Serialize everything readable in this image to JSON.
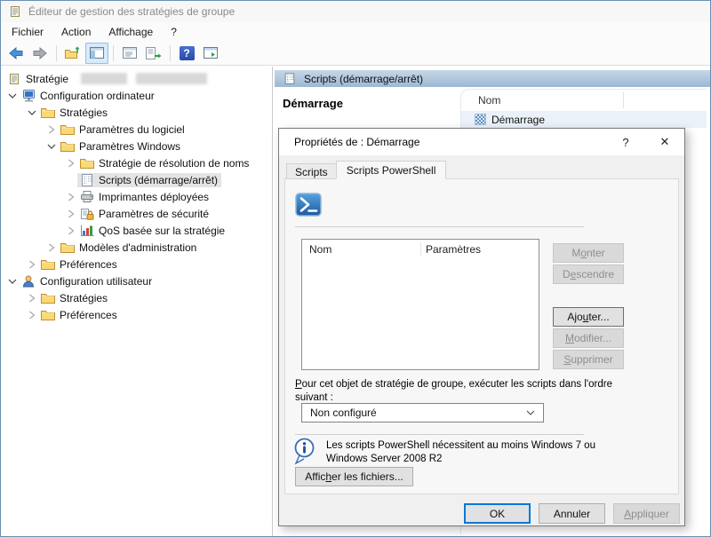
{
  "window": {
    "title": "Éditeur de gestion des stratégies de groupe",
    "menu": [
      "Fichier",
      "Action",
      "Affichage",
      "?"
    ],
    "toolbar_icons": [
      "back",
      "forward",
      "up-one-level",
      "show-console-tree",
      "properties",
      "export-list",
      "help",
      "extended-view"
    ],
    "help_glyph": "?"
  },
  "tree": {
    "items": [
      {
        "label": "Stratégie",
        "level": 0,
        "icon": "gpo-scroll",
        "expander": "none",
        "redacted": true
      },
      {
        "label": "Configuration ordinateur",
        "level": 1,
        "icon": "computer",
        "expander": "expanded"
      },
      {
        "label": "Stratégies",
        "level": 2,
        "icon": "folder",
        "expander": "expanded"
      },
      {
        "label": "Paramètres du logiciel",
        "level": 3,
        "icon": "folder",
        "expander": "collapsed"
      },
      {
        "label": "Paramètres Windows",
        "level": 3,
        "icon": "folder",
        "expander": "expanded"
      },
      {
        "label": "Stratégie de résolution de noms",
        "level": 4,
        "icon": "folder",
        "expander": "collapsed"
      },
      {
        "label": "Scripts (démarrage/arrêt)",
        "level": 4,
        "icon": "script",
        "expander": "none",
        "selected": true
      },
      {
        "label": "Imprimantes déployées",
        "level": 4,
        "icon": "printer",
        "expander": "collapsed"
      },
      {
        "label": "Paramètres de sécurité",
        "level": 4,
        "icon": "security",
        "expander": "collapsed"
      },
      {
        "label": "QoS basée sur la stratégie",
        "level": 4,
        "icon": "qos-chart",
        "expander": "collapsed"
      },
      {
        "label": "Modèles d'administration",
        "level": 3,
        "icon": "folder",
        "expander": "collapsed"
      },
      {
        "label": "Préférences",
        "level": 2,
        "icon": "folder",
        "expander": "collapsed"
      },
      {
        "label": "Configuration utilisateur",
        "level": 1,
        "icon": "user",
        "expander": "expanded"
      },
      {
        "label": "Stratégies",
        "level": 2,
        "icon": "folder",
        "expander": "collapsed"
      },
      {
        "label": "Préférences",
        "level": 2,
        "icon": "folder",
        "expander": "collapsed"
      }
    ]
  },
  "results": {
    "header": "Scripts (démarrage/arrêt)",
    "selected_name": "Démarrage",
    "column": "Nom",
    "rows": [
      "Démarrage"
    ]
  },
  "dialog": {
    "title": "Propriétés de : Démarrage",
    "controls": {
      "help": "?",
      "close": "✕"
    },
    "tabs": [
      "Scripts",
      "Scripts PowerShell"
    ],
    "active_tab": "Scripts PowerShell",
    "list": {
      "columns": [
        "Nom",
        "Paramètres"
      ],
      "rows": []
    },
    "buttons": {
      "monter": {
        "pre": "M",
        "accel": "o",
        "post": "nter"
      },
      "descendre": {
        "pre": "D",
        "accel": "e",
        "post": "scendre"
      },
      "ajouter": {
        "pre": "Ajo",
        "accel": "u",
        "post": "ter..."
      },
      "modifier": {
        "pre": "",
        "accel": "M",
        "post": "odifier..."
      },
      "supprimer": {
        "pre": "",
        "accel": "S",
        "post": "upprimer"
      }
    },
    "order_label": {
      "pre": "",
      "accel": "P",
      "post": "our cet objet de stratégie de groupe, exécuter les scripts dans l'ordre suivant :"
    },
    "order_value": "Non configuré",
    "info_text": "Les scripts PowerShell nécessitent au moins Windows 7 ou Windows Server 2008 R2",
    "show_files": {
      "pre": "Affic",
      "accel": "h",
      "post": "er les fichiers..."
    },
    "footer": {
      "ok": "OK",
      "annuler": "Annuler",
      "appliquer": {
        "pre": "",
        "accel": "A",
        "post": "ppliquer"
      }
    }
  },
  "colors": {
    "accent": "#0078d7",
    "header_bar": "#a6bfd8",
    "tree_selection": "#e4e4e4",
    "row_selection": "#ebf1f8"
  }
}
